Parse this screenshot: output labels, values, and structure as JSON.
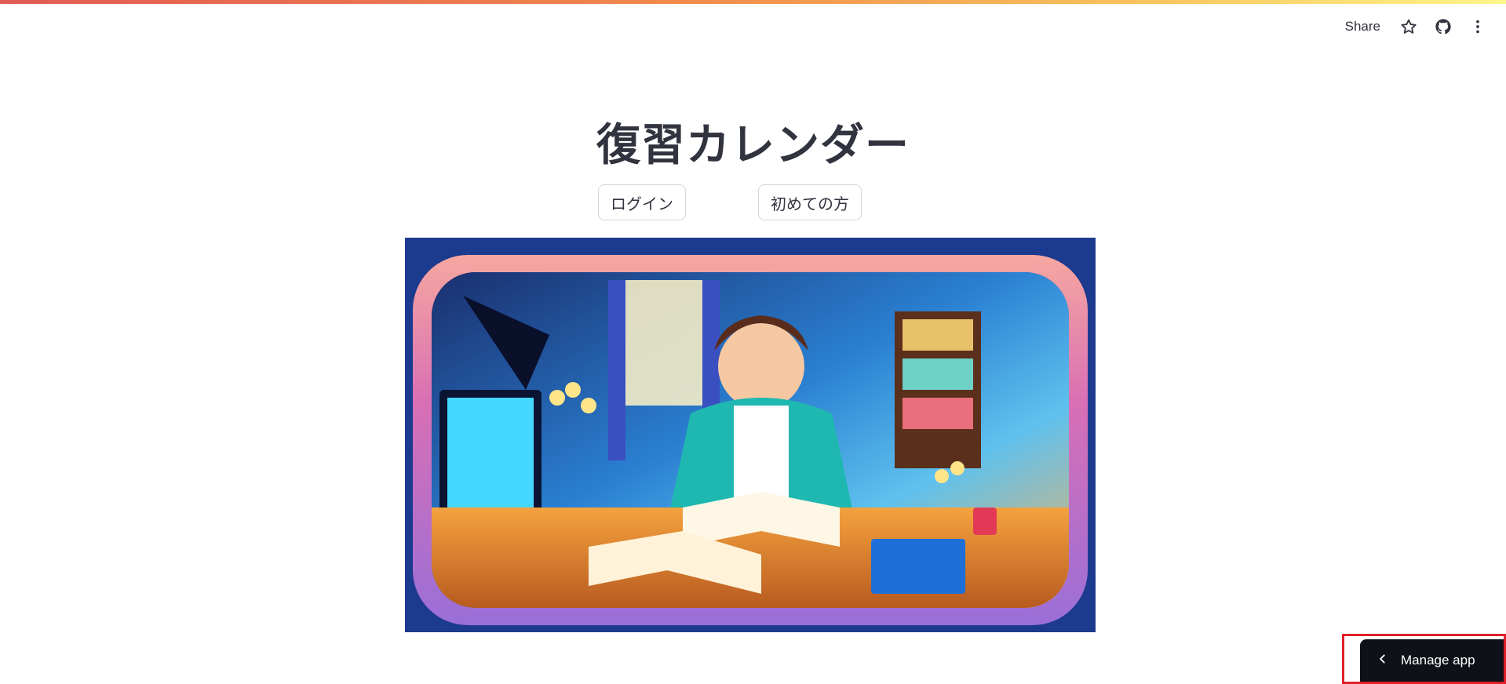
{
  "header": {
    "share_label": "Share",
    "icons": [
      "star-icon",
      "github-icon",
      "more-vertical-icon"
    ]
  },
  "main": {
    "title": "復習カレンダー",
    "buttons": {
      "login_label": "ログイン",
      "first_time_label": "初めての方"
    },
    "hero_image": {
      "alt": "Anime-style illustration of a student studying at a desk with books"
    }
  },
  "footer": {
    "manage_label": "Manage app"
  },
  "colors": {
    "accent_gradient": [
      "#e25a55",
      "#f8c15d",
      "#fdf58a"
    ],
    "text": "#31333f",
    "manage_bg": "#0e1117",
    "highlight": "#e0202a"
  }
}
